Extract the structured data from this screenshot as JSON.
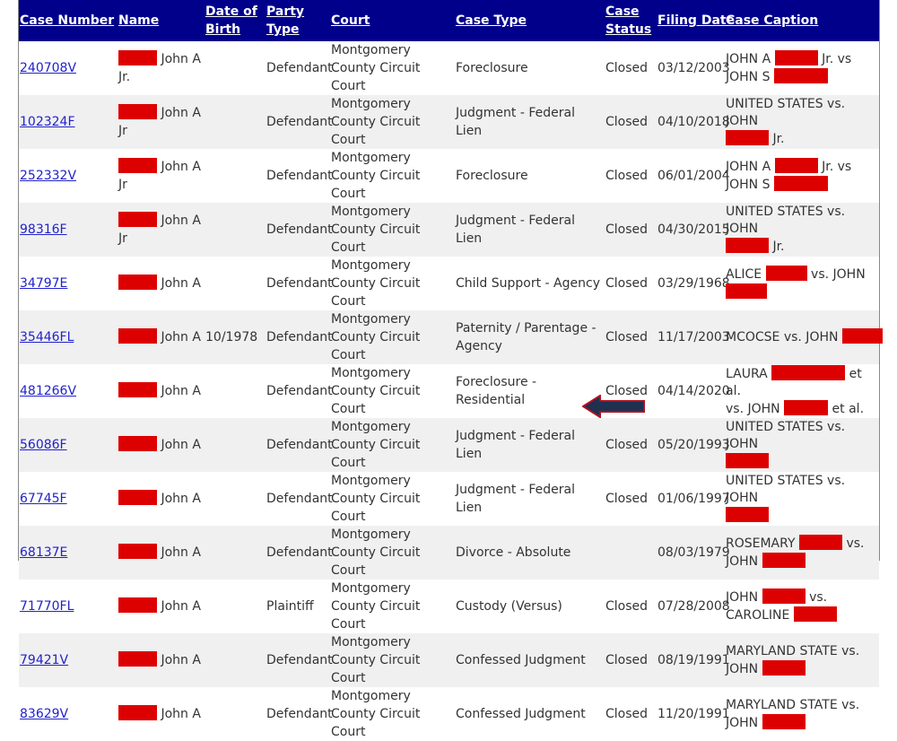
{
  "table": {
    "headers": {
      "case_number": "Case Number",
      "name": "Name",
      "dob": "Date of Birth",
      "party_type": "Party Type",
      "court": "Court",
      "case_type": "Case Type",
      "case_status": "Case Status",
      "filing_date": "Filing Date",
      "case_caption": "Case Caption"
    },
    "rows": [
      {
        "case": "240708V",
        "name_a": "John A",
        "name_b": "Jr.",
        "dob": "",
        "party": "Defendant",
        "court": "Montgomery County Circuit Court",
        "type": "Foreclosure",
        "status": "Closed",
        "date": "03/12/2003",
        "cap1": "JOHN A",
        "cap2": "Jr. vs",
        "cap3": "JOHN S",
        "cap4": ""
      },
      {
        "case": "102324F",
        "name_a": "John A",
        "name_b": "Jr",
        "dob": "",
        "party": "Defendant",
        "court": "Montgomery County Circuit Court",
        "type": "Judgment - Federal Lien",
        "status": "Closed",
        "date": "04/10/2018",
        "cap1": "UNITED STATES vs. JOHN",
        "cap2": "",
        "cap3": "",
        "cap4": "Jr."
      },
      {
        "case": "252332V",
        "name_a": "John A",
        "name_b": "Jr",
        "dob": "",
        "party": "Defendant",
        "court": "Montgomery County Circuit Court",
        "type": "Foreclosure",
        "status": "Closed",
        "date": "06/01/2004",
        "cap1": "JOHN A",
        "cap2": "Jr. vs",
        "cap3": "JOHN S",
        "cap4": ""
      },
      {
        "case": "98316F",
        "name_a": "John A",
        "name_b": "Jr",
        "dob": "",
        "party": "Defendant",
        "court": "Montgomery County Circuit Court",
        "type": "Judgment - Federal Lien",
        "status": "Closed",
        "date": "04/30/2015",
        "cap1": "UNITED STATES vs. JOHN",
        "cap2": "",
        "cap3": "",
        "cap4": "Jr."
      },
      {
        "case": "34797E",
        "name_a": "John A",
        "name_b": "",
        "dob": "",
        "party": "Defendant",
        "court": "Montgomery County Circuit Court",
        "type": "Child Support - Agency",
        "status": "Closed",
        "date": "03/29/1968",
        "cap1": "ALICE",
        "cap2": "vs. JOHN",
        "cap3": "",
        "cap4": ""
      },
      {
        "case": "35446FL",
        "name_a": "John A",
        "name_b": "",
        "dob": "10/1978",
        "party": "Defendant",
        "court": "Montgomery County Circuit Court",
        "type": "Paternity / Parentage - Agency",
        "status": "Closed",
        "date": "11/17/2003",
        "cap1": "MCOCSE vs. JOHN",
        "cap2": "",
        "cap3": "",
        "cap4": ""
      },
      {
        "case": "481266V",
        "name_a": "John A",
        "name_b": "",
        "dob": "",
        "party": "Defendant",
        "court": "Montgomery County Circuit Court",
        "type": "Foreclosure - Residential",
        "status": "Closed",
        "date": "04/14/2020",
        "cap1": "LAURA",
        "cap2": "et al.",
        "cap3": "vs. JOHN",
        "cap4": "et al."
      },
      {
        "case": "56086F",
        "name_a": "John A",
        "name_b": "",
        "dob": "",
        "party": "Defendant",
        "court": "Montgomery County Circuit Court",
        "type": "Judgment - Federal Lien",
        "status": "Closed",
        "date": "05/20/1993",
        "cap1": "UNITED STATES vs. JOHN",
        "cap2": "",
        "cap3": "",
        "cap4": ""
      },
      {
        "case": "67745F",
        "name_a": "John A",
        "name_b": "",
        "dob": "",
        "party": "Defendant",
        "court": "Montgomery County Circuit Court",
        "type": "Judgment - Federal Lien",
        "status": "Closed",
        "date": "01/06/1997",
        "cap1": "UNITED STATES vs. JOHN",
        "cap2": "",
        "cap3": "",
        "cap4": ""
      },
      {
        "case": "68137E",
        "name_a": "John A",
        "name_b": "",
        "dob": "",
        "party": "Defendant",
        "court": "Montgomery County Circuit Court",
        "type": "Divorce - Absolute",
        "status": "",
        "date": "08/03/1979",
        "cap1": "ROSEMARY",
        "cap2": "vs.",
        "cap3": "JOHN",
        "cap4": ""
      },
      {
        "case": "71770FL",
        "name_a": "John A",
        "name_b": "",
        "dob": "",
        "party": "Plaintiff",
        "court": "Montgomery County Circuit Court",
        "type": "Custody (Versus)",
        "status": "Closed",
        "date": "07/28/2008",
        "cap1": "JOHN",
        "cap2": "vs.",
        "cap3": "CAROLINE",
        "cap4": ""
      },
      {
        "case": "79421V",
        "name_a": "John A",
        "name_b": "",
        "dob": "",
        "party": "Defendant",
        "court": "Montgomery County Circuit Court",
        "type": "Confessed Judgment",
        "status": "Closed",
        "date": "08/19/1991",
        "cap1": "MARYLAND STATE vs.",
        "cap2": "",
        "cap3": "JOHN",
        "cap4": ""
      },
      {
        "case": "83629V",
        "name_a": "John A",
        "name_b": "",
        "dob": "",
        "party": "Defendant",
        "court": "Montgomery County Circuit Court",
        "type": "Confessed Judgment",
        "status": "Closed",
        "date": "11/20/1991",
        "cap1": "MARYLAND STATE vs.",
        "cap2": "",
        "cap3": "JOHN",
        "cap4": ""
      }
    ]
  },
  "annotation": {
    "icon": "left-arrow-icon",
    "fill": "#1f3050",
    "stroke": "#b01020"
  },
  "colors": {
    "header_bg": "#00008b",
    "redaction": "#dd0000",
    "link": "#2222cc"
  }
}
